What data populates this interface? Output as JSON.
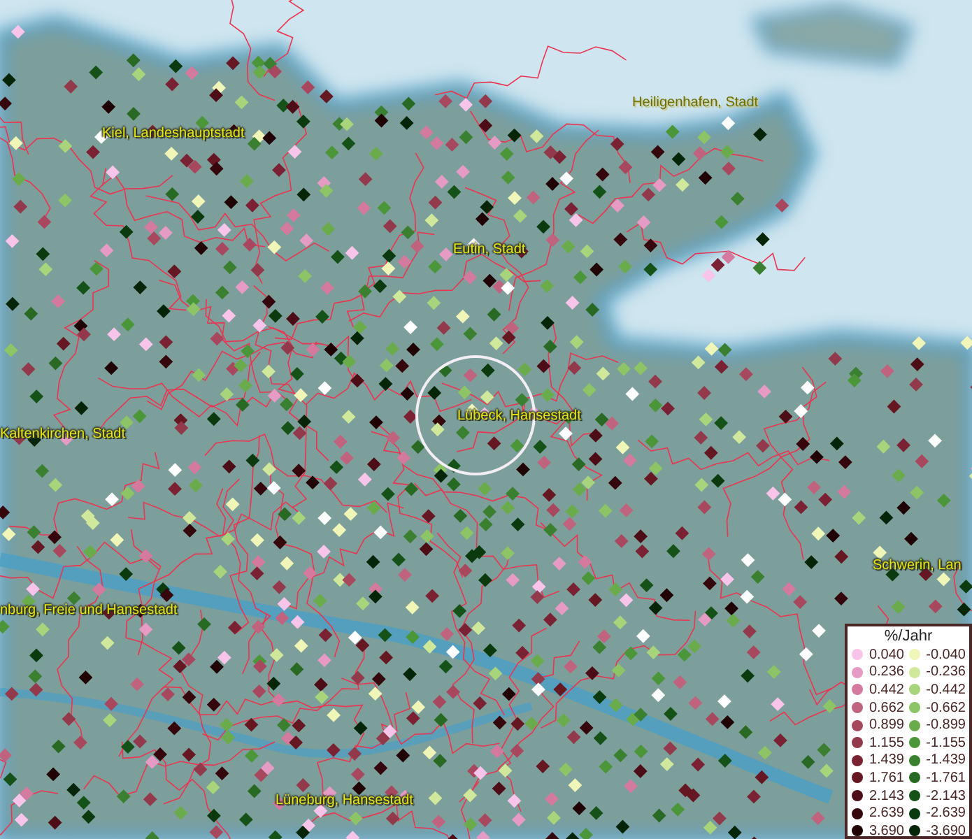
{
  "map": {
    "places": [
      {
        "name": "Heiligenhafen, Stadt"
      },
      {
        "name": "Kiel, Landeshauptstadt"
      },
      {
        "name": "Eutin, Stadt"
      },
      {
        "name": "Lübeck, Hansestadt"
      },
      {
        "name": "Kaltenkirchen, Stadt"
      },
      {
        "name": "Schwerin, Lan"
      },
      {
        "name": "nburg, Freie und Hansestadt"
      },
      {
        "name": "Lüneburg, Hansestadt"
      }
    ]
  },
  "legend": {
    "title": "%/Jahr",
    "columns": [
      {
        "items": [
          {
            "label": "0.040",
            "color": "#f9c4ea"
          },
          {
            "label": "0.236",
            "color": "#e59bc4"
          },
          {
            "label": "0.442",
            "color": "#d47a9f"
          },
          {
            "label": "0.662",
            "color": "#c0637f"
          },
          {
            "label": "0.899",
            "color": "#a8485f"
          },
          {
            "label": "1.155",
            "color": "#923a4c"
          },
          {
            "label": "1.439",
            "color": "#7a2233"
          },
          {
            "label": "1.761",
            "color": "#651722"
          },
          {
            "label": "2.143",
            "color": "#4d0d16"
          },
          {
            "label": "2.639",
            "color": "#35060c"
          },
          {
            "label": "3.690",
            "color": "#200205"
          }
        ]
      },
      {
        "items": [
          {
            "label": "-0.040",
            "color": "#f0f5b8"
          },
          {
            "label": "-0.236",
            "color": "#d0e89c"
          },
          {
            "label": "-0.442",
            "color": "#a8d47c"
          },
          {
            "label": "-0.662",
            "color": "#8cc466"
          },
          {
            "label": "-0.899",
            "color": "#6aac4c"
          },
          {
            "label": "-1.155",
            "color": "#4c963a"
          },
          {
            "label": "-1.439",
            "color": "#3a8030"
          },
          {
            "label": "-1.761",
            "color": "#286a24"
          },
          {
            "label": "-2.143",
            "color": "#155218"
          },
          {
            "label": "-2.639",
            "color": "#0a3a0e"
          },
          {
            "label": "-3.690",
            "color": "#052508"
          }
        ]
      }
    ]
  }
}
